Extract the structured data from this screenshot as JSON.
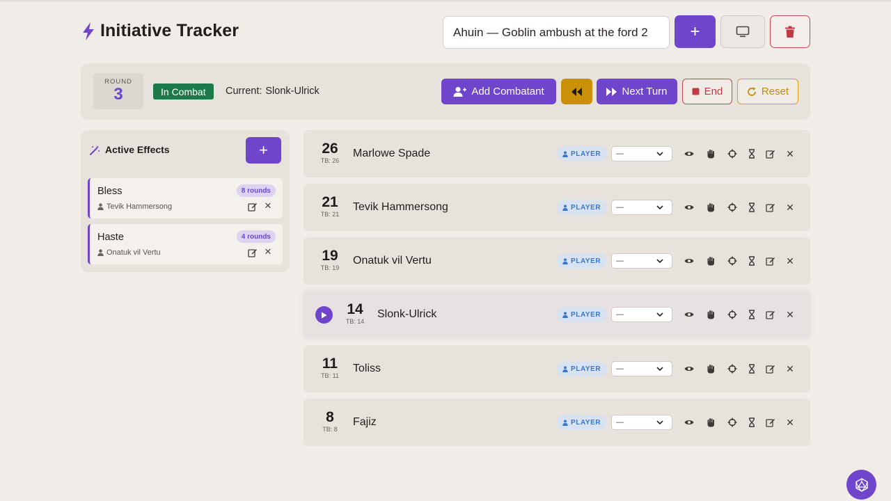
{
  "app": {
    "title": "Initiative Tracker"
  },
  "header": {
    "session_value": "Ahuin — Goblin ambush at the ford 2",
    "add_button": "+",
    "colors": {
      "accent": "#6f45cc",
      "danger": "#c8474f"
    }
  },
  "combat": {
    "round_label": "ROUND",
    "round_number": "3",
    "status": "In Combat",
    "current_label": "Current:",
    "current_name": "Slonk-Ulrick",
    "buttons": {
      "add_combatant": "Add Combatant",
      "next_turn": "Next Turn",
      "end": "End",
      "reset": "Reset"
    },
    "status_color": "#1b7a48",
    "prev_button_color": "#c9910a"
  },
  "effects": {
    "title": "Active Effects",
    "add_button": "+",
    "items": [
      {
        "name": "Bless",
        "duration": "8 rounds",
        "target": "Tevik Hammersong"
      },
      {
        "name": "Haste",
        "duration": "4 rounds",
        "target": "Onatuk vil Vertu"
      }
    ]
  },
  "combatants": [
    {
      "initiative": "26",
      "tiebreak": "TB: 26",
      "name": "Marlowe Spade",
      "type": "PLAYER",
      "condition": "—",
      "active": false
    },
    {
      "initiative": "21",
      "tiebreak": "TB: 21",
      "name": "Tevik Hammersong",
      "type": "PLAYER",
      "condition": "—",
      "active": false
    },
    {
      "initiative": "19",
      "tiebreak": "TB: 19",
      "name": "Onatuk vil Vertu",
      "type": "PLAYER",
      "condition": "—",
      "active": false
    },
    {
      "initiative": "14",
      "tiebreak": "TB: 14",
      "name": "Slonk-Ulrick",
      "type": "PLAYER",
      "condition": "—",
      "active": true
    },
    {
      "initiative": "11",
      "tiebreak": "TB: 11",
      "name": "Toliss",
      "type": "PLAYER",
      "condition": "—",
      "active": false
    },
    {
      "initiative": "8",
      "tiebreak": "TB: 8",
      "name": "Fajiz",
      "type": "PLAYER",
      "condition": "—",
      "active": false
    }
  ],
  "icons": {
    "title": "lightning-icon",
    "display": "monitor-icon",
    "delete": "trash-icon",
    "effects": "magic-wand-icon",
    "fab": "d20-dice-icon",
    "row_actions": [
      "eye-icon",
      "hand-icon",
      "crosshair-icon",
      "hourglass-icon",
      "edit-icon",
      "close-icon"
    ]
  }
}
